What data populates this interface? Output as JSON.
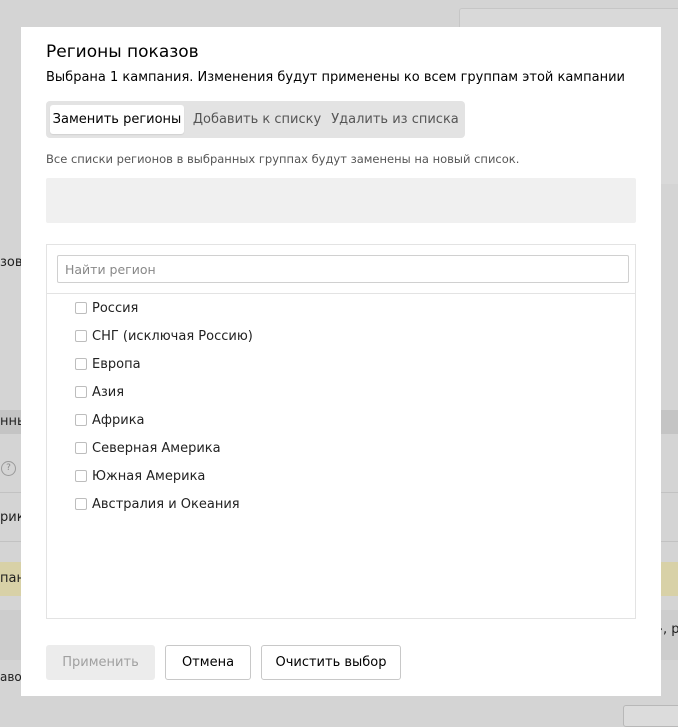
{
  "background": {
    "text_1": "зов",
    "text_2": "нны",
    "text_3": "рика",
    "text_4": "пан",
    "text_5": "», ру",
    "text_6": "авок",
    "help_glyph": "?"
  },
  "dialog": {
    "title": "Регионы показов",
    "subtitle": "Выбрана 1 кампания. Изменения будут применены ко всем группам этой кампании",
    "tabs": [
      {
        "label": "Заменить регионы",
        "active": true
      },
      {
        "label": "Добавить к списку",
        "active": false
      },
      {
        "label": "Удалить из списка",
        "active": false
      }
    ],
    "note": "Все списки регионов в выбранных группах будут заменены на новый список.",
    "search": {
      "placeholder": "Найти регион",
      "value": ""
    },
    "regions": [
      {
        "label": "Россия",
        "checked": false
      },
      {
        "label": "СНГ (исключая Россию)",
        "checked": false
      },
      {
        "label": "Европа",
        "checked": false
      },
      {
        "label": "Азия",
        "checked": false
      },
      {
        "label": "Африка",
        "checked": false
      },
      {
        "label": "Северная Америка",
        "checked": false
      },
      {
        "label": "Южная Америка",
        "checked": false
      },
      {
        "label": "Австралия и Океания",
        "checked": false
      }
    ],
    "buttons": {
      "apply": "Применить",
      "cancel": "Отмена",
      "clear": "Очистить выбор"
    }
  }
}
